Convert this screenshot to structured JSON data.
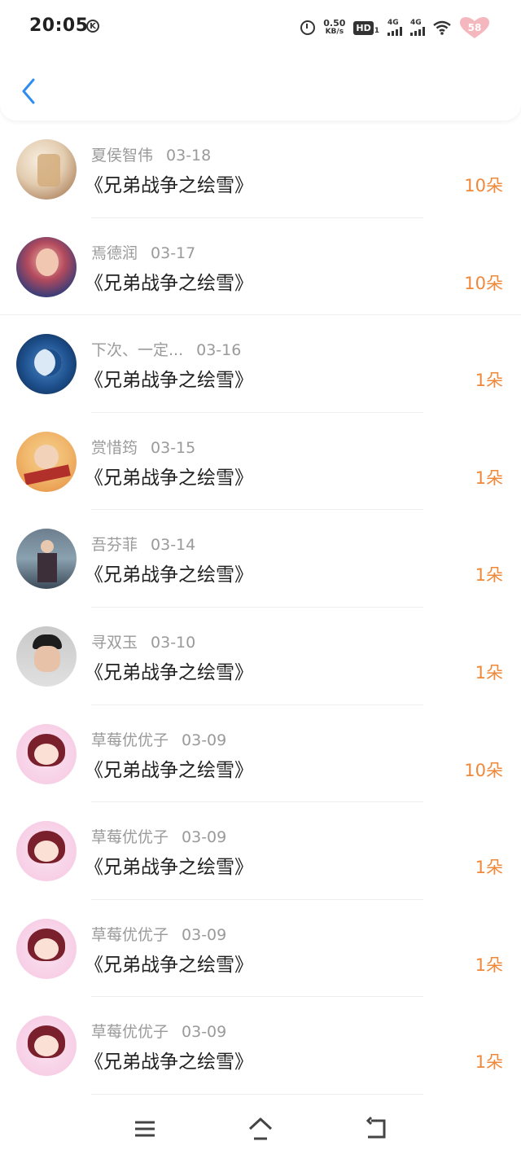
{
  "status_bar": {
    "time": "20:05",
    "k_badge": "K",
    "speed_value": "0.50",
    "speed_unit": "KB/s",
    "hd_label": "HD",
    "hd_sub": "1",
    "sim1_label": "4G",
    "sim2_label": "4G",
    "battery_level": "58",
    "battery_color": "#f4b7bd"
  },
  "header": {
    "back_icon": "chevron-left-icon",
    "accent_color": "#2f8cf1"
  },
  "list": [
    {
      "name": "夏侯智伟",
      "date": "03-18",
      "title": "《兄弟战争之绘雪》",
      "amount": "10朵",
      "avatar": "jar"
    },
    {
      "name": "焉德润",
      "date": "03-17",
      "title": "《兄弟战争之绘雪》",
      "amount": "10朵",
      "avatar": "girl"
    },
    {
      "name": "下次、一定...",
      "date": "03-16",
      "title": "《兄弟战争之绘雪》",
      "amount": "1朵",
      "avatar": "moon"
    },
    {
      "name": "赏惜筠",
      "date": "03-15",
      "title": "《兄弟战争之绘雪》",
      "amount": "1朵",
      "avatar": "scarf"
    },
    {
      "name": "吾芬菲",
      "date": "03-14",
      "title": "《兄弟战争之绘雪》",
      "amount": "1朵",
      "avatar": "photo"
    },
    {
      "name": "寻双玉",
      "date": "03-10",
      "title": "《兄弟战争之绘雪》",
      "amount": "1朵",
      "avatar": "boy"
    },
    {
      "name": "草莓优优子",
      "date": "03-09",
      "title": "《兄弟战争之绘雪》",
      "amount": "10朵",
      "avatar": "anime"
    },
    {
      "name": "草莓优优子",
      "date": "03-09",
      "title": "《兄弟战争之绘雪》",
      "amount": "1朵",
      "avatar": "anime"
    },
    {
      "name": "草莓优优子",
      "date": "03-09",
      "title": "《兄弟战争之绘雪》",
      "amount": "1朵",
      "avatar": "anime"
    },
    {
      "name": "草莓优优子",
      "date": "03-09",
      "title": "《兄弟战争之绘雪》",
      "amount": "1朵",
      "avatar": "anime"
    }
  ],
  "colors": {
    "amount": "#f0883a",
    "meta": "#9a9a9a",
    "title": "#222222"
  },
  "nav": {
    "menu_icon": "menu-icon",
    "home_icon": "home-icon",
    "back_icon": "back-arrow-icon"
  }
}
